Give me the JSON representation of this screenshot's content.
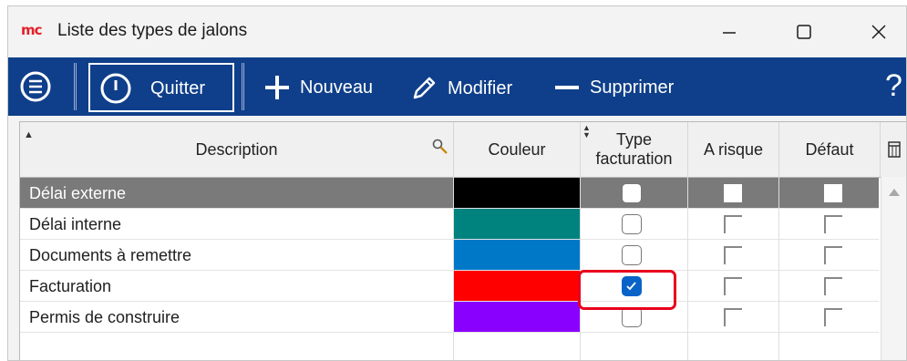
{
  "window": {
    "title": "Liste des types de jalons",
    "logo": "mc",
    "controls": [
      "minimize",
      "maximize",
      "close"
    ]
  },
  "toolbar": {
    "menu_icon": "hamburger-circle-icon",
    "quit_label": "Quitter",
    "new_label": "Nouveau",
    "edit_label": "Modifier",
    "delete_label": "Supprimer",
    "help_label": "?"
  },
  "table": {
    "columns": {
      "description": "Description",
      "color": "Couleur",
      "type_line1": "Type",
      "type_line2": "facturation",
      "risk": "A risque",
      "default": "Défaut"
    },
    "rows": [
      {
        "description": "Délai externe",
        "color": "#000000",
        "type_facturation": false,
        "a_risque": false,
        "defaut": false,
        "selected": true
      },
      {
        "description": "Délai interne",
        "color": "#00827f",
        "type_facturation": false,
        "a_risque": false,
        "defaut": false,
        "selected": false
      },
      {
        "description": "Documents à remettre",
        "color": "#0078c8",
        "type_facturation": false,
        "a_risque": false,
        "defaut": false,
        "selected": false
      },
      {
        "description": "Facturation",
        "color": "#ff0000",
        "type_facturation": true,
        "a_risque": false,
        "defaut": false,
        "selected": false
      },
      {
        "description": "Permis de construire",
        "color": "#8a00ff",
        "type_facturation": false,
        "a_risque": false,
        "defaut": false,
        "selected": false
      }
    ]
  },
  "colors": {
    "toolbar_bg": "#0f3f8a",
    "selection_bg": "#7a7a7a",
    "highlight": "#e8001c"
  }
}
